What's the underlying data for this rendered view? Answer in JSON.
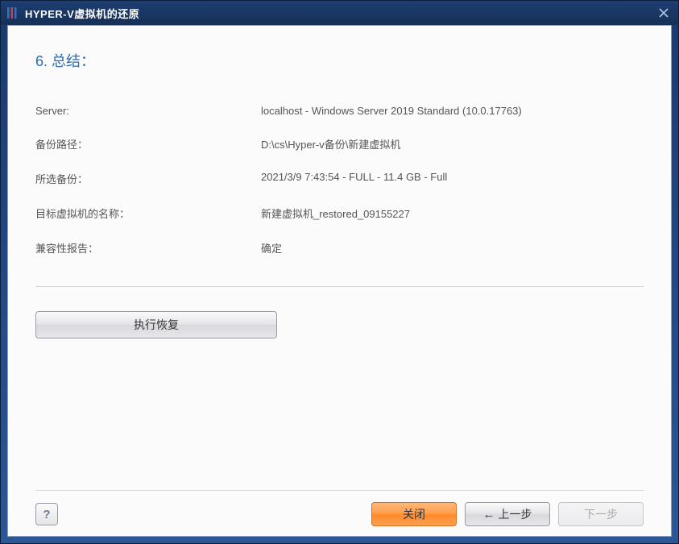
{
  "titlebar": {
    "title": "HYPER-V虚拟机的还原"
  },
  "step": {
    "number": "6",
    "title": "总结："
  },
  "summary": {
    "rows": [
      {
        "label": "Server:",
        "value": "localhost - Windows Server 2019 Standard (10.0.17763)"
      },
      {
        "label": "备份路径：",
        "value": "D:\\cs\\Hyper-v备份\\新建虚拟机"
      },
      {
        "label": "所选备份：",
        "value": "2021/3/9 7:43:54 - FULL - 11.4 GB - Full"
      },
      {
        "label": "目标虚拟机的名称：",
        "value": "新建虚拟机_restored_09155227"
      },
      {
        "label": "兼容性报告：",
        "value": "确定"
      }
    ]
  },
  "buttons": {
    "execute": "执行恢复",
    "help": "?",
    "close": "关闭",
    "prev": "上一步",
    "next": "下一步"
  }
}
